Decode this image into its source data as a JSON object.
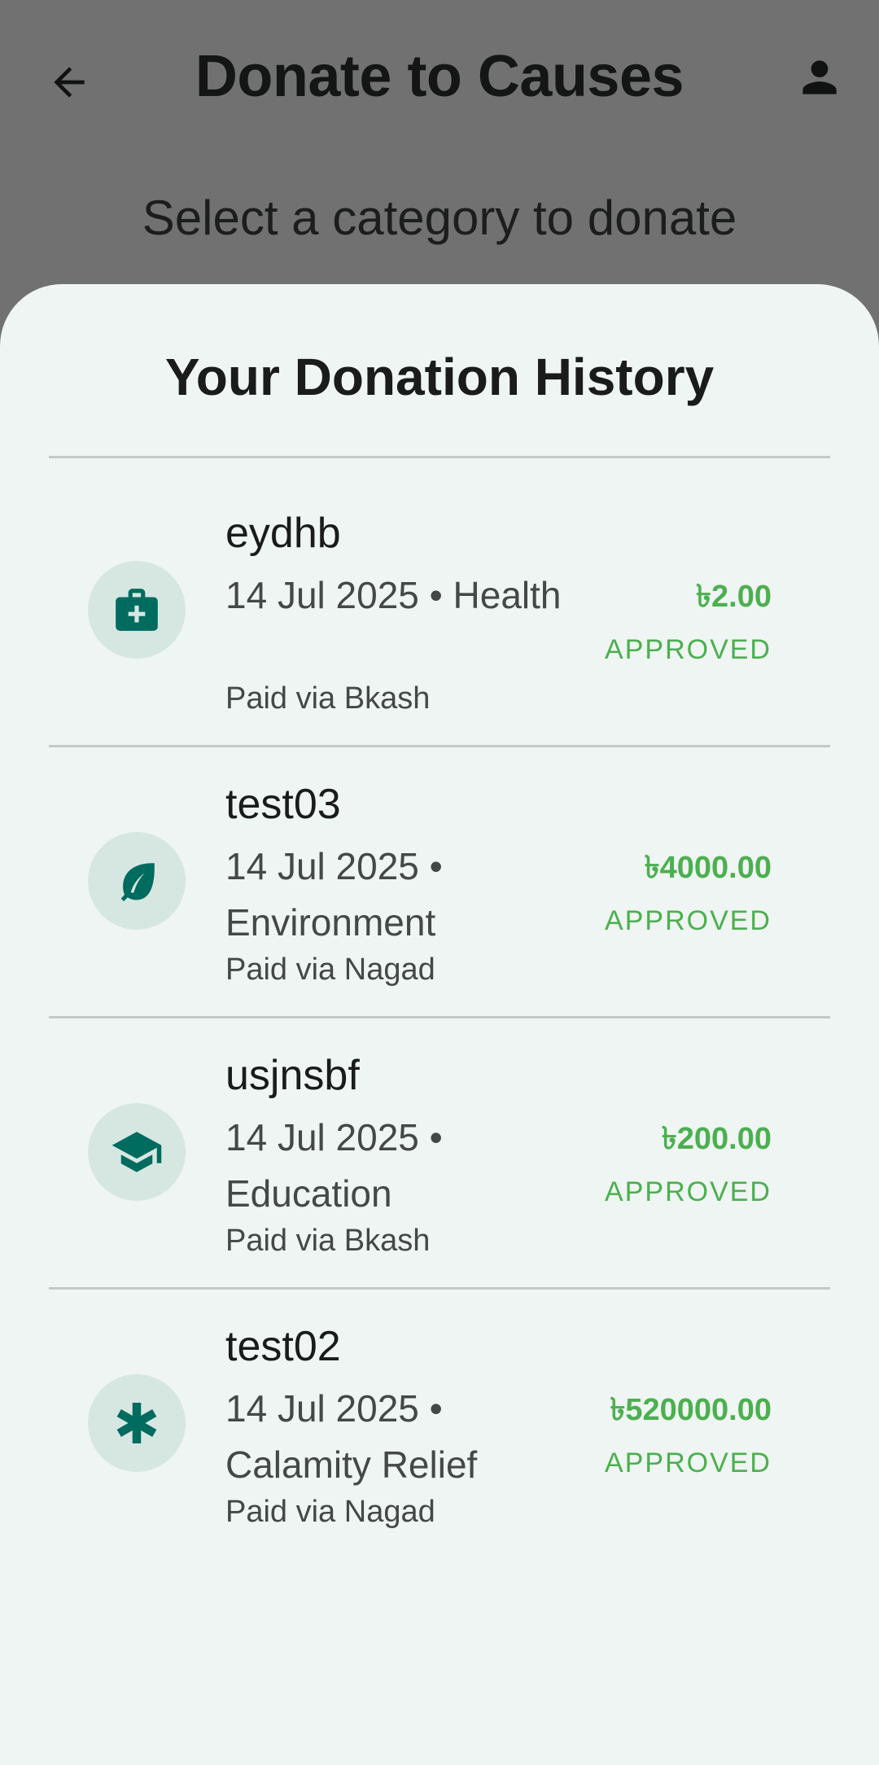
{
  "appbar": {
    "title": "Donate to Causes",
    "back_icon": "arrow-back-icon",
    "profile_icon": "person-icon"
  },
  "subtitle": "Select a category to donate",
  "history": {
    "title": "Your Donation History",
    "accent_color": "#4caf50",
    "icon_color": "#006b5f",
    "items": [
      {
        "name": "eydhb",
        "date": "14 Jul 2025",
        "category": "Health",
        "paid": "Paid via Bkash",
        "amount": "৳2.00",
        "status": "APPROVED",
        "icon": "medical-bag-icon"
      },
      {
        "name": "test03",
        "date": "14 Jul 2025",
        "category": "Environment",
        "paid": "Paid via Nagad",
        "amount": "৳4000.00",
        "status": "APPROVED",
        "icon": "leaf-icon"
      },
      {
        "name": "usjnsbf",
        "date": "14 Jul 2025",
        "category": "Education",
        "paid": "Paid via Bkash",
        "amount": "৳200.00",
        "status": "APPROVED",
        "icon": "graduation-cap-icon"
      },
      {
        "name": "test02",
        "date": "14 Jul 2025",
        "category": "Calamity Relief",
        "paid": "Paid via Nagad",
        "amount": "৳520000.00",
        "status": "APPROVED",
        "icon": "asterisk-icon"
      }
    ]
  }
}
